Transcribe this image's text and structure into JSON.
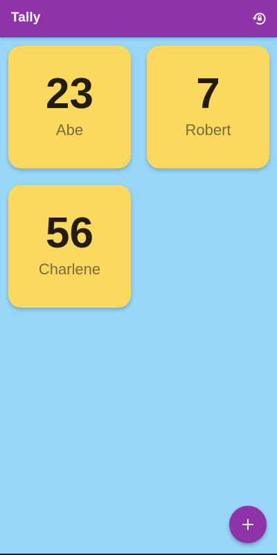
{
  "app_bar": {
    "title": "Tally",
    "actions": [
      {
        "icon": "reset-history-icon"
      }
    ]
  },
  "counters": [
    {
      "count": "23",
      "name": "Abe"
    },
    {
      "count": "7",
      "name": "Robert"
    },
    {
      "count": "56",
      "name": "Charlene"
    }
  ],
  "fab": {
    "icon": "plus-icon"
  },
  "colors": {
    "primary": "#8e33a8",
    "background": "#98d7f9",
    "card": "#fbd95f",
    "count_text": "#221d0e",
    "name_text": "#776a3e"
  }
}
